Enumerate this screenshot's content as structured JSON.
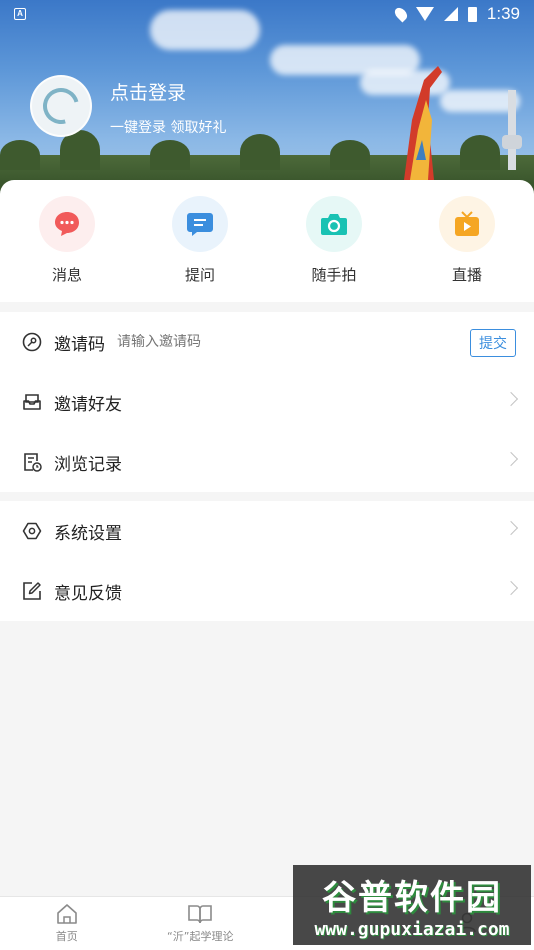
{
  "status_bar": {
    "notification_letter": "A",
    "time": "1:39"
  },
  "profile": {
    "title": "点击登录",
    "subtitle": "一键登录  领取好礼"
  },
  "quick_actions": [
    {
      "label": "消息",
      "icon": "message-bubble-icon",
      "color": "#f15a5a",
      "bg": "#fdeeee"
    },
    {
      "label": "提问",
      "icon": "question-chat-icon",
      "color": "#3b8ede",
      "bg": "#e9f3fc"
    },
    {
      "label": "随手拍",
      "icon": "camera-icon",
      "color": "#19c2b3",
      "bg": "#e6f8f6"
    },
    {
      "label": "直播",
      "icon": "tv-live-icon",
      "color": "#f5a623",
      "bg": "#fef4e4"
    }
  ],
  "invite": {
    "label": "邀请码",
    "placeholder": "请输入邀请码",
    "submit": "提交"
  },
  "menu_group_1": [
    {
      "label": "邀请好友",
      "icon": "inbox-icon"
    },
    {
      "label": "浏览记录",
      "icon": "history-icon"
    }
  ],
  "menu_group_2": [
    {
      "label": "系统设置",
      "icon": "settings-hexagon-icon"
    },
    {
      "label": "意见反馈",
      "icon": "edit-feedback-icon"
    }
  ],
  "bottom_nav": [
    {
      "label": "首页",
      "icon": "home-icon"
    },
    {
      "label": "“沂”起学理论",
      "icon": "open-book-icon"
    },
    {
      "label": "",
      "icon": "center-icon"
    },
    {
      "label": "",
      "icon": "user-icon"
    }
  ],
  "watermark": {
    "title": "谷普软件园",
    "url": "www.gupuxiazai.com"
  },
  "colors": {
    "accent": "#3b8ede",
    "chevron": "#c4c4c4"
  }
}
